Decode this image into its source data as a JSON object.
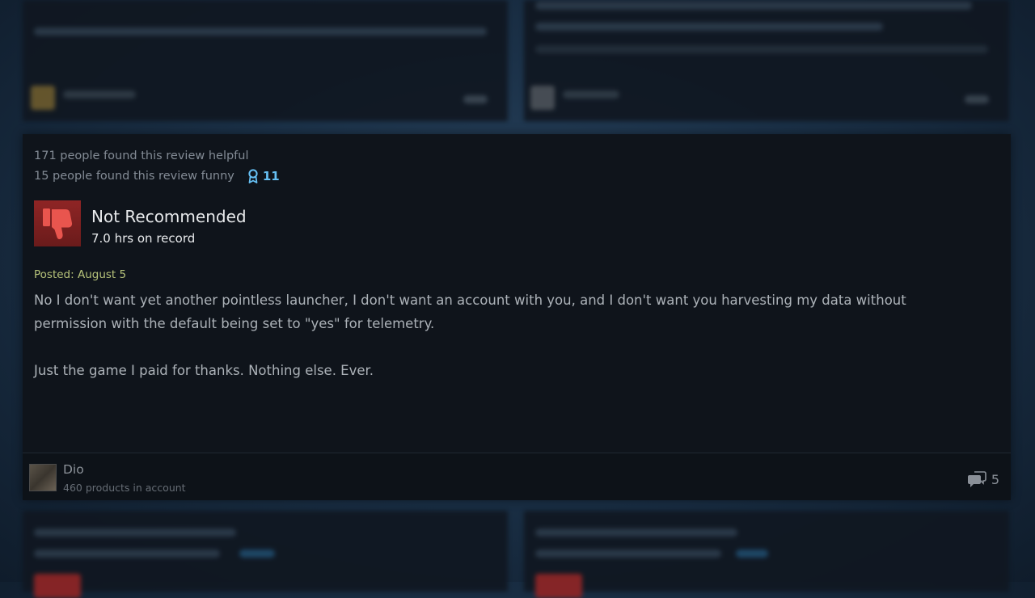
{
  "review": {
    "helpful_text": "171 people found this review helpful",
    "funny_text": "15 people found this review funny",
    "award_count": "11",
    "recommendation": "Not Recommended",
    "hours": "7.0 hrs on record",
    "posted": "Posted: August 5",
    "body": [
      "No I don't want yet another pointless launcher, I don't want an account with you, and I don't want you harvesting my data without permission with the default being set to \"yes\" for telemetry.",
      "Just the game I paid for thanks. Nothing else. Ever."
    ],
    "author": {
      "name": "Dio",
      "products": "460 products in account"
    },
    "comment_count": "5"
  },
  "colors": {
    "accent": "#66c0f4",
    "thumb_bg": "#8f2525",
    "posted": "#b7c37a"
  },
  "icons": {
    "award": "award-ribbon-icon",
    "recommendation": "thumbs-down-icon",
    "comments": "comment-bubbles-icon"
  }
}
